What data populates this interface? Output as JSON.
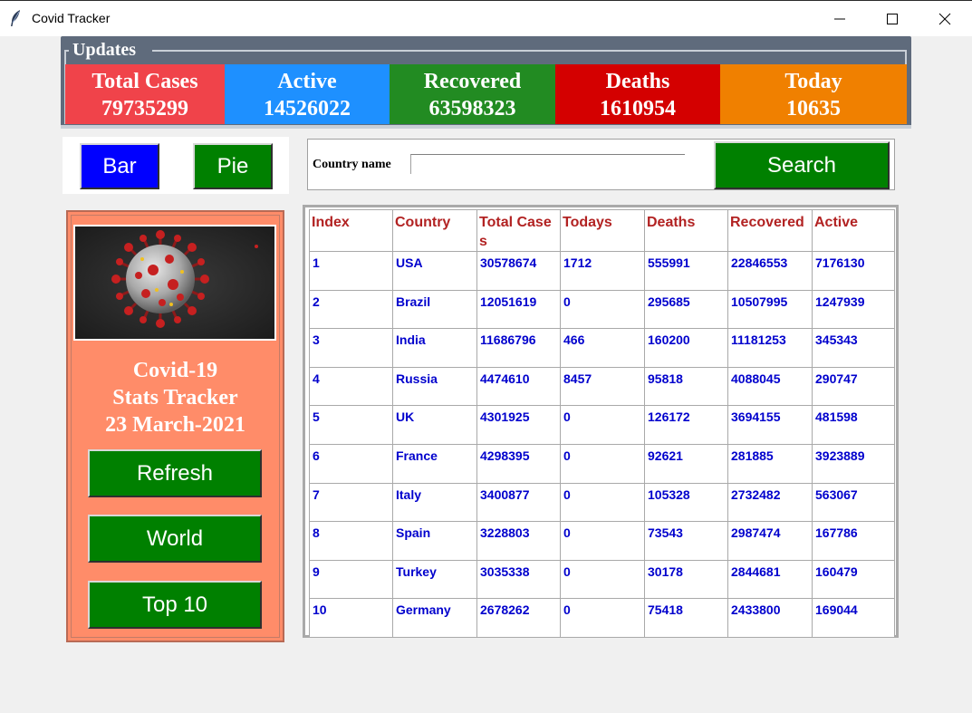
{
  "window": {
    "title": "Covid Tracker"
  },
  "updates": {
    "title": "Updates",
    "stats": [
      {
        "label": "Total Cases",
        "value": "79735299",
        "color": "#f0434a"
      },
      {
        "label": "Active",
        "value": "14526022",
        "color": "#1e90ff"
      },
      {
        "label": "Recovered",
        "value": "63598323",
        "color": "#228b22"
      },
      {
        "label": "Deaths",
        "value": "1610954",
        "color": "#d40000"
      },
      {
        "label": "Today",
        "value": "10635",
        "color": "#f08000"
      }
    ]
  },
  "chart_buttons": {
    "bar": "Bar",
    "pie": "Pie"
  },
  "search": {
    "label": "Country name",
    "value": "",
    "button": "Search"
  },
  "side_panel": {
    "line1": "Covid-19",
    "line2": "Stats Tracker",
    "line3": "23 March-2021",
    "refresh": "Refresh",
    "world": "World",
    "top10": "Top 10"
  },
  "table": {
    "headers": [
      "Index",
      "Country",
      "Total Cases",
      "Todays",
      "Deaths",
      "Recovered",
      "Active"
    ],
    "rows": [
      [
        "1",
        "USA",
        "30578674",
        "1712",
        "555991",
        "22846553",
        "7176130"
      ],
      [
        "2",
        "Brazil",
        "12051619",
        "0",
        "295685",
        "10507995",
        "1247939"
      ],
      [
        "3",
        "India",
        "11686796",
        "466",
        "160200",
        "11181253",
        "345343"
      ],
      [
        "4",
        "Russia",
        "4474610",
        "8457",
        "95818",
        "4088045",
        "290747"
      ],
      [
        "5",
        "UK",
        "4301925",
        "0",
        "126172",
        "3694155",
        "481598"
      ],
      [
        "6",
        "France",
        "4298395",
        "0",
        "92621",
        "281885",
        "3923889"
      ],
      [
        "7",
        "Italy",
        "3400877",
        "0",
        "105328",
        "2732482",
        "563067"
      ],
      [
        "8",
        "Spain",
        "3228803",
        "0",
        "73543",
        "2987474",
        "167786"
      ],
      [
        "9",
        "Turkey",
        "3035338",
        "0",
        "30178",
        "2844681",
        "160479"
      ],
      [
        "10",
        "Germany",
        "2678262",
        "0",
        "75418",
        "2433800",
        "169044"
      ]
    ]
  }
}
